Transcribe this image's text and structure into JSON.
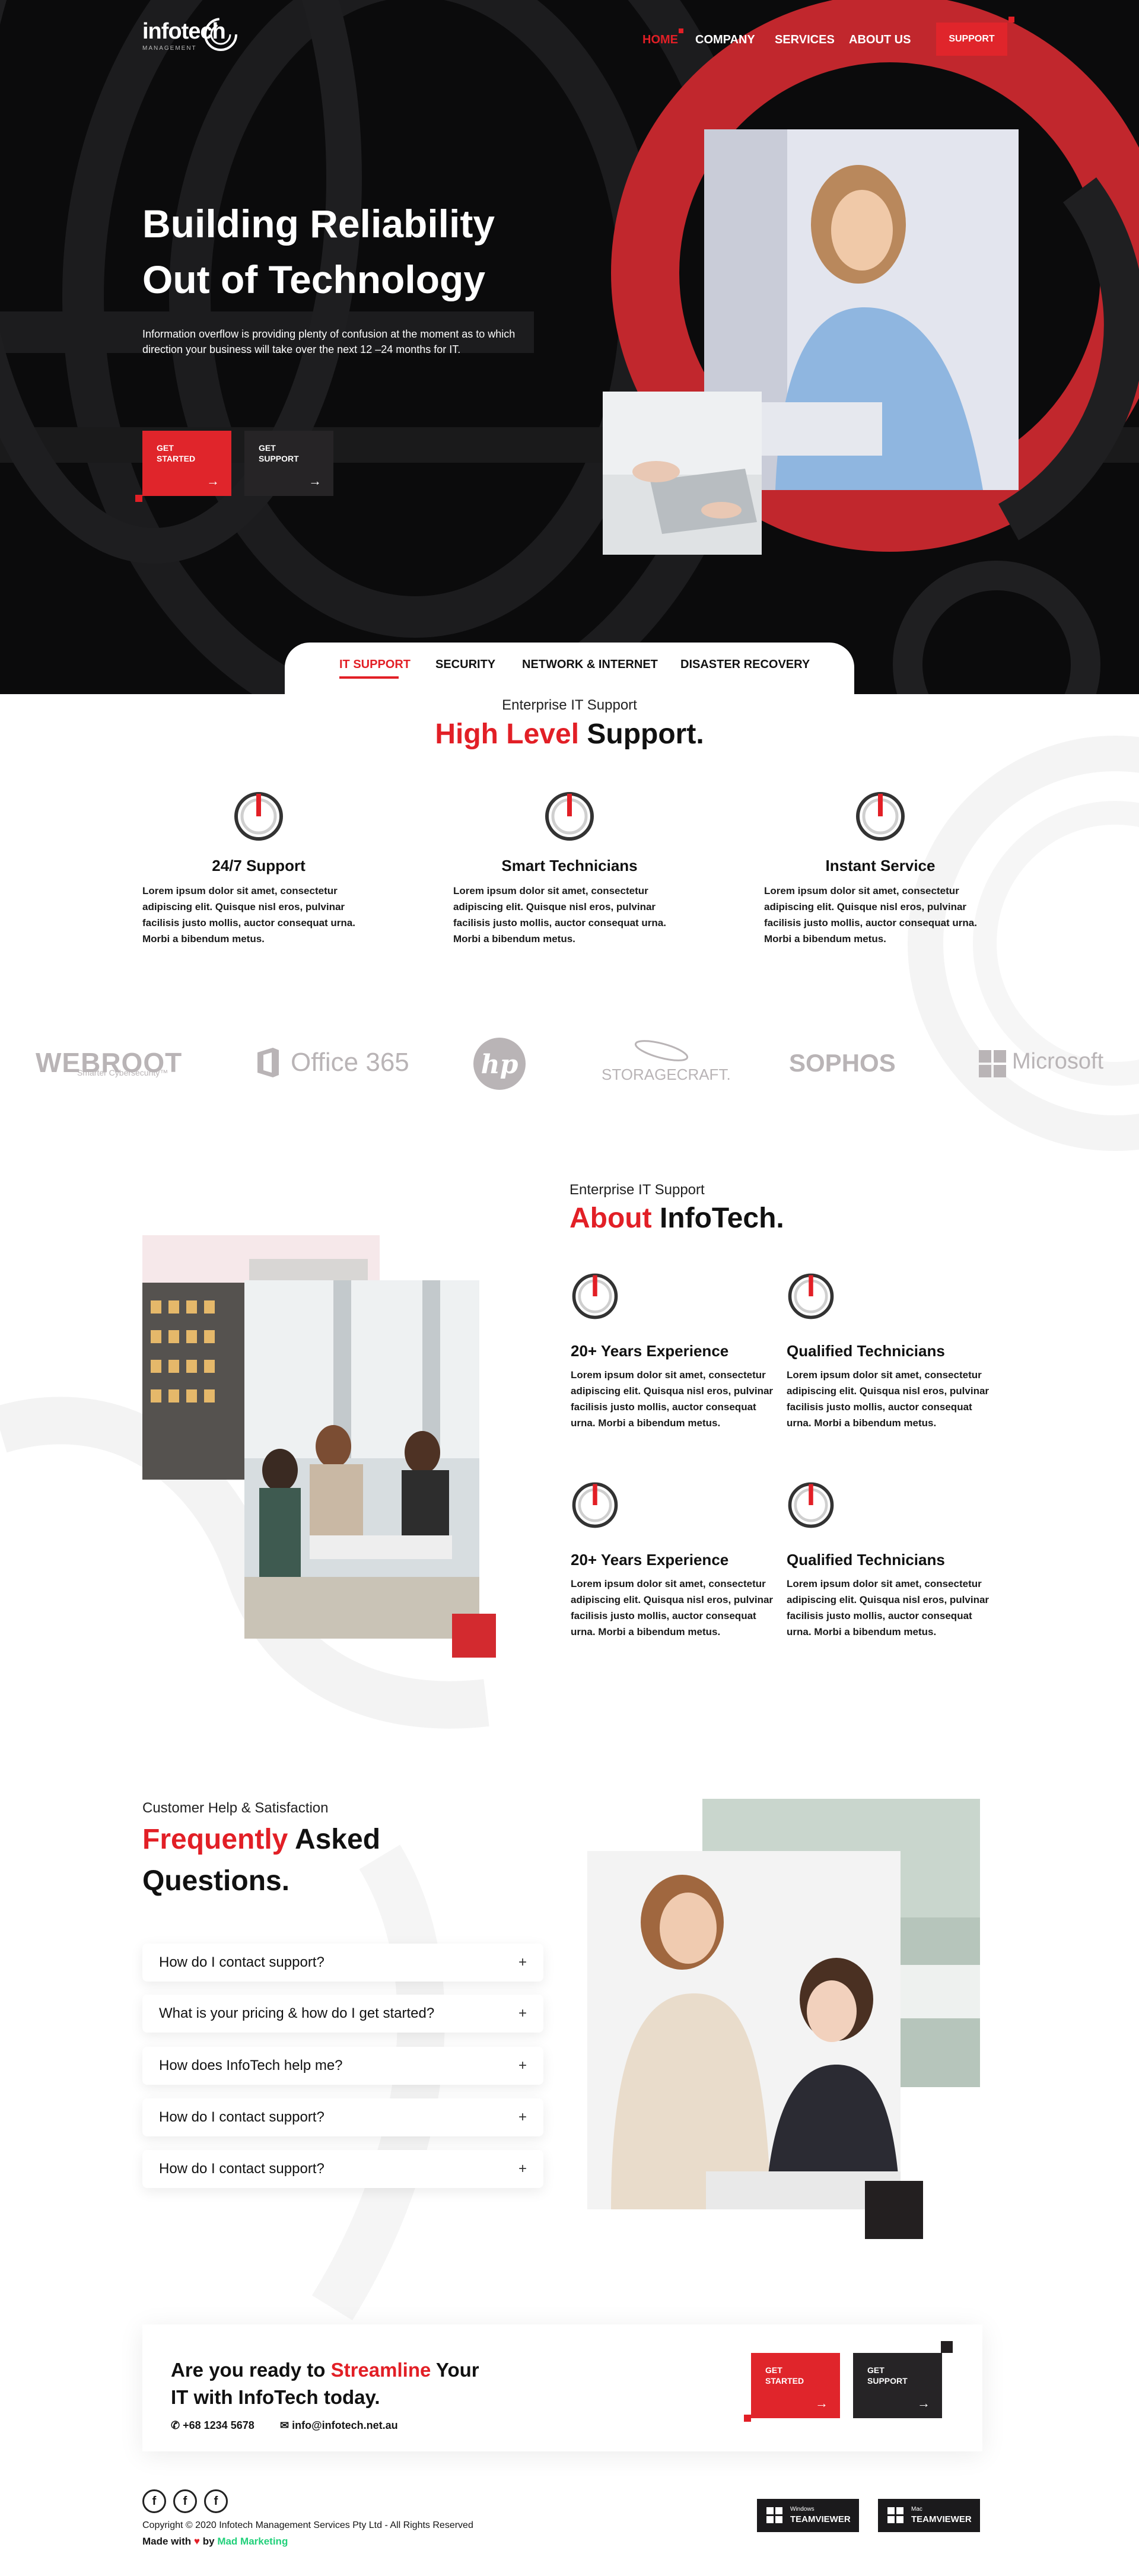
{
  "colors": {
    "accent": "#e21f26",
    "dark": "#0b0b0c",
    "button_dark": "#262426"
  },
  "header": {
    "logo": {
      "name": "infotech",
      "sub": "MANAGEMENT"
    },
    "nav": [
      "HOME",
      "COMPANY",
      "SERVICES",
      "ABOUT US"
    ],
    "support_label": "SUPPORT"
  },
  "hero": {
    "title_line1": "Building Reliability",
    "title_line2": "Out of Technology",
    "text": "Information overflow is providing plenty of confusion at the moment as to which direction your business will take over the next 12 –24 months for IT.",
    "get_started": [
      "GET",
      "STARTED"
    ],
    "get_support": [
      "GET",
      "SUPPORT"
    ]
  },
  "tabs": [
    "IT SUPPORT",
    "SECURITY",
    "NETWORK & INTERNET",
    "DISASTER RECOVERY"
  ],
  "support": {
    "eyebrow": "Enterprise IT Support",
    "heading_red": "High Level",
    "heading_dark": "Support.",
    "features": [
      {
        "title": "24/7 Support",
        "text": "Lorem ipsum dolor sit amet, consectetur adipiscing elit. Quisque nisl eros, pulvinar facilisis justo mollis, auctor consequat urna. Morbi a bibendum metus."
      },
      {
        "title": "Smart Technicians",
        "text": "Lorem ipsum dolor sit amet, consectetur adipiscing elit. Quisque nisl eros, pulvinar facilisis justo mollis, auctor consequat urna. Morbi a bibendum metus."
      },
      {
        "title": "Instant Service",
        "text": "Lorem ipsum dolor sit amet, consectetur adipiscing elit. Quisque nisl eros, pulvinar facilisis justo mollis, auctor consequat urna. Morbi a bibendum metus."
      }
    ]
  },
  "brands": {
    "webroot": "WEBROOT",
    "webroot_sub": "Smarter Cybersecurity™",
    "office": "Office 365",
    "hp": "hp",
    "storagecraft": "STORAGECRAFT.",
    "sophos": "SOPHOS",
    "microsoft": "Microsoft"
  },
  "about": {
    "eyebrow": "Enterprise IT Support",
    "heading_red": "About",
    "heading_dark": "InfoTech.",
    "items": [
      {
        "title": "20+ Years Experience",
        "text": "Lorem ipsum dolor sit amet, consectetur adipiscing elit. Quisqua nisl eros, pulvinar facilisis justo mollis, auctor consequat urna. Morbi a bibendum metus."
      },
      {
        "title": "Qualified Technicians",
        "text": "Lorem ipsum dolor sit amet, consectetur adipiscing elit. Quisqua nisl eros, pulvinar facilisis justo mollis, auctor consequat urna. Morbi a bibendum metus."
      },
      {
        "title": "20+ Years Experience",
        "text": "Lorem ipsum dolor sit amet, consectetur adipiscing elit. Quisqua nisl eros, pulvinar facilisis justo mollis, auctor consequat urna. Morbi a bibendum metus."
      },
      {
        "title": "Qualified Technicians",
        "text": "Lorem ipsum dolor sit amet, consectetur adipiscing elit. Quisqua nisl eros, pulvinar facilisis justo mollis, auctor consequat urna. Morbi a bibendum metus."
      }
    ]
  },
  "faq": {
    "eyebrow": "Customer Help & Satisfaction",
    "heading_red": "Frequently",
    "heading_dark1": "Asked",
    "heading_dark2": "Questions.",
    "questions": [
      "How do I contact support?",
      "What is your pricing & how do I get started?",
      "How does InfoTech help me?",
      "How do I contact support?",
      "How do I contact support?"
    ],
    "toggle_symbol": "+"
  },
  "banner": {
    "line1_a": "Are you ready to",
    "line1_red": "Streamline",
    "line1_b": "Your",
    "line2": "IT with InfoTech today.",
    "phone": "+68 1234 5678",
    "email": "info@infotech.net.au",
    "get_started": [
      "GET",
      "STARTED"
    ],
    "get_support": [
      "GET",
      "SUPPORT"
    ]
  },
  "footer": {
    "copyright": "Copyright © 2020 Infotech Management Services Pty Ltd - All Rights Reserved",
    "made_with": "Made with",
    "by": "by",
    "agency": "Mad Marketing",
    "teamviewer_windows": [
      "Windows",
      "TEAMVIEWER"
    ],
    "teamviewer_mac": [
      "Mac",
      "TEAMVIEWER"
    ]
  }
}
